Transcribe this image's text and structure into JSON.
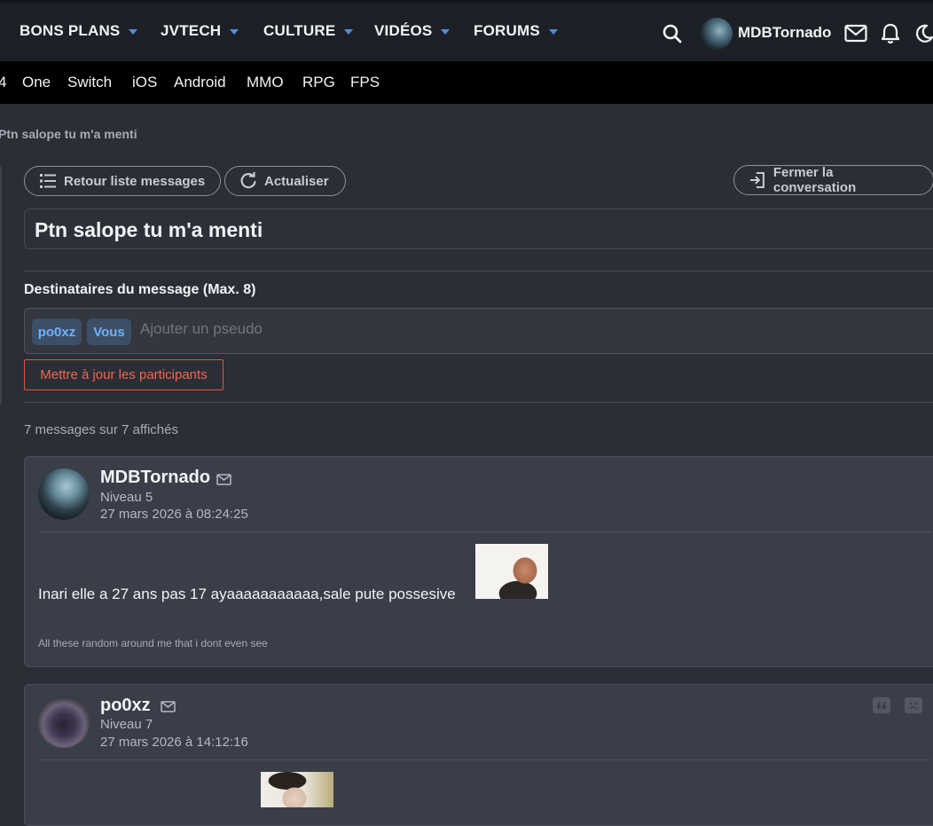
{
  "nav": {
    "items": [
      "BONS PLANS",
      "JVTECH",
      "CULTURE",
      "VIDÉOS",
      "FORUMS"
    ],
    "username": "MDBTornado"
  },
  "subnav": {
    "items": [
      "4",
      "One",
      "Switch",
      "iOS",
      "Android",
      "MMO",
      "RPG",
      "FPS"
    ]
  },
  "breadcrumb": "Ptn salope tu m'a menti",
  "actions": {
    "back": "Retour liste messages",
    "refresh": "Actualiser",
    "close": "Fermer la conversation"
  },
  "conversation": {
    "title": "Ptn salope tu m'a menti",
    "recipients_label": "Destinataires du message (Max. 8)",
    "recipients": [
      "po0xz",
      "Vous"
    ],
    "add_placeholder": "Ajouter un pseudo",
    "update_button": "Mettre à jour les participants",
    "count_text": "7 messages sur 7 affichés"
  },
  "messages": [
    {
      "author": "MDBTornado",
      "level": "Niveau 5",
      "date": "27 mars 2026 à 08:24:25",
      "text": "Inari elle a 27 ans pas 17 ayaaaaaaaaaaa,sale pute possesive",
      "signature": "All these random around me that i dont even see"
    },
    {
      "author": "po0xz",
      "level": "Niveau 7",
      "date": "27 mars 2026 à 14:12:16"
    }
  ],
  "colors": {
    "accent": "#4e8fe0",
    "danger": "#e2543d",
    "chip_text": "#6fb0ff"
  }
}
